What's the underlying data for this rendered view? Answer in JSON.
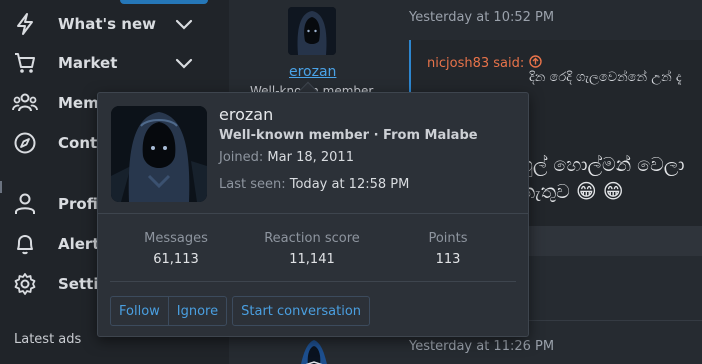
{
  "sidebar": {
    "items": [
      {
        "label": "What's new",
        "icon": "bolt-icon",
        "has_chevron": true
      },
      {
        "label": "Market",
        "icon": "cart-icon",
        "has_chevron": true
      },
      {
        "label": "Members",
        "icon": "users-icon",
        "has_chevron": false
      },
      {
        "label": "Contact",
        "icon": "compass-icon",
        "has_chevron": false
      },
      {
        "label": "Profile",
        "icon": "user-icon",
        "has_chevron": false
      },
      {
        "label": "Alerts",
        "icon": "bell-icon",
        "has_chevron": false
      },
      {
        "label": "Settings",
        "icon": "gear-icon",
        "has_chevron": false
      }
    ],
    "section_heading": "Latest ads"
  },
  "post": {
    "timestamp_top": "Yesterday at 10:52 PM",
    "timestamp_bottom": "Yesterday at 11:26 PM",
    "author": "erozan",
    "author_title_peek": "Well-known member",
    "quote": {
      "author_said": "nicjosh83 said:",
      "text": "දින රෙදි ගැලවෙන්නේ උන් දැ"
    },
    "body_line1": "ෆුල් හොල්මන් වෙලා",
    "body_line2": "නැතුව",
    "emoji": "😁"
  },
  "tooltip": {
    "name": "erozan",
    "title": "Well-known member · From Malabe",
    "joined_label": "Joined:",
    "joined_value": "Mar 18, 2011",
    "last_seen_label": "Last seen:",
    "last_seen_value": "Today at 12:58 PM",
    "stats": [
      {
        "label": "Messages",
        "value": "61,113"
      },
      {
        "label": "Reaction score",
        "value": "11,141"
      },
      {
        "label": "Points",
        "value": "113"
      }
    ],
    "buttons": {
      "follow": "Follow",
      "ignore": "Ignore",
      "start_conversation": "Start conversation"
    }
  },
  "colors": {
    "accent": "#2577b8",
    "link": "#4aa3e8",
    "quote_author": "#e8734a"
  }
}
